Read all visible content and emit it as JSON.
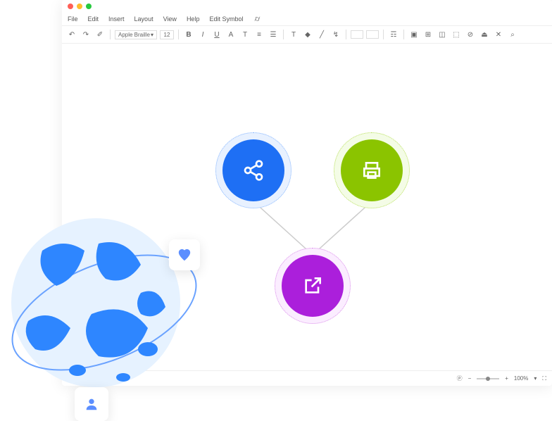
{
  "menu": {
    "file": "File",
    "edit": "Edit",
    "insert": "Insert",
    "layout": "Layout",
    "view": "View",
    "help": "Help",
    "edit_symbol": "Edit Symbol"
  },
  "toolbar": {
    "font_name": "Apple Braille",
    "font_size": "12"
  },
  "status": {
    "zoom": "100%"
  },
  "diagram": {
    "nodes": [
      {
        "id": "share",
        "color": "#1e6ff4"
      },
      {
        "id": "printer",
        "color": "#8bc400"
      },
      {
        "id": "export",
        "color": "#ab1fdb"
      }
    ]
  }
}
